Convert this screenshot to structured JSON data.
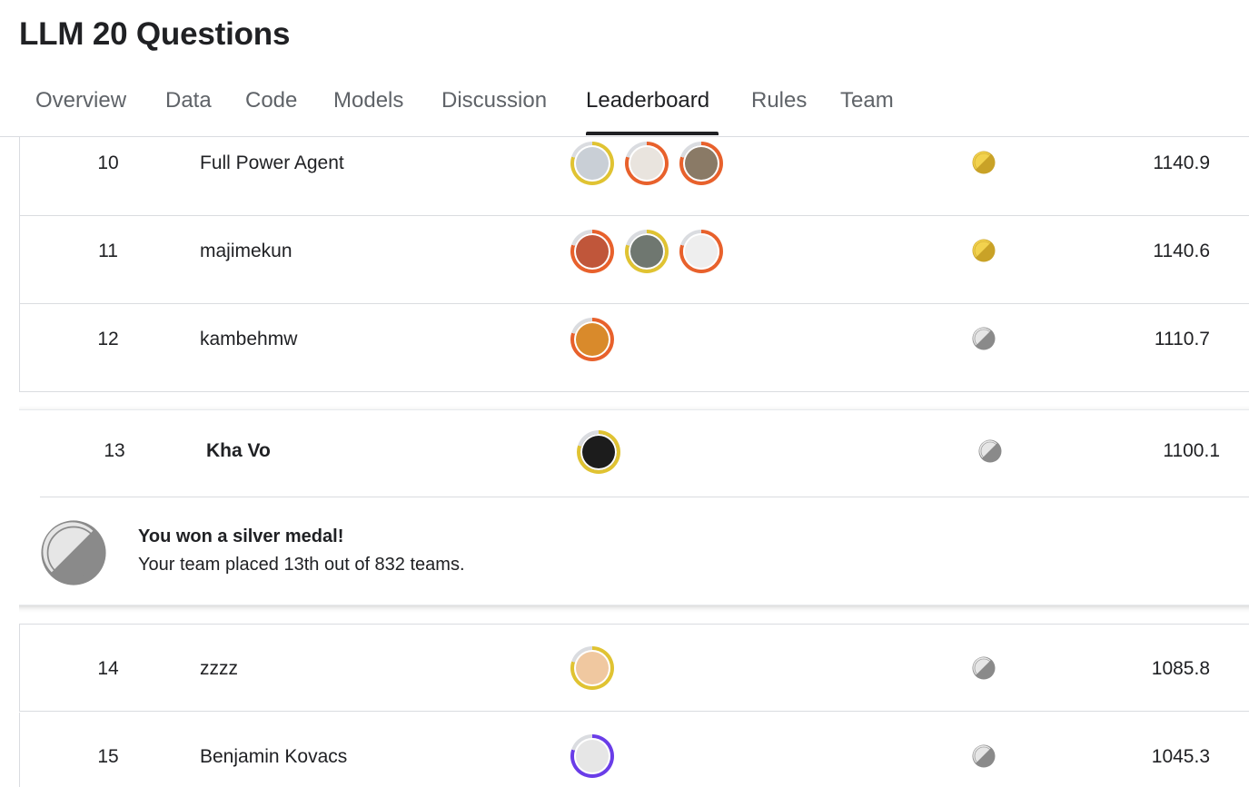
{
  "page": {
    "title": "LLM 20 Questions"
  },
  "tabs": [
    "Overview",
    "Data",
    "Code",
    "Models",
    "Discussion",
    "Leaderboard",
    "Rules",
    "Team"
  ],
  "active_tab": "Leaderboard",
  "medal_colors": {
    "gold": "#c9a227",
    "silver": "#8a8a8a",
    "ring_gold": "#e0c332",
    "ring_orange": "#e8612c",
    "ring_purple": "#6a3de8"
  },
  "rows": [
    {
      "rank": "10",
      "team": "Full Power Agent",
      "medal": "gold",
      "score": "1140.9",
      "avatars": [
        {
          "ring": "gold",
          "fill": "#c9cfd6"
        },
        {
          "ring": "orange",
          "fill": "#e9e4de"
        },
        {
          "ring": "orange",
          "fill": "#8a7a66"
        }
      ]
    },
    {
      "rank": "11",
      "team": "majimekun",
      "medal": "gold",
      "score": "1140.6",
      "avatars": [
        {
          "ring": "orange",
          "fill": "#c0563a"
        },
        {
          "ring": "gold",
          "fill": "#6f7770"
        },
        {
          "ring": "orange",
          "fill": "#eeeeee"
        }
      ]
    },
    {
      "rank": "12",
      "team": "kambehmw",
      "medal": "silver",
      "score": "1110.7",
      "avatars": [
        {
          "ring": "orange",
          "fill": "#d98a2b"
        }
      ]
    }
  ],
  "my_row": {
    "rank": "13",
    "team": "Kha Vo",
    "medal": "silver",
    "score": "1100.1",
    "avatars": [
      {
        "ring": "gold",
        "fill": "#1c1c1c"
      }
    ],
    "message_title": "You won a silver medal!",
    "message_body": "Your team placed 13th out of 832 teams."
  },
  "rows_after": [
    {
      "rank": "14",
      "team": "zzzz",
      "medal": "silver",
      "score": "1085.8",
      "avatars": [
        {
          "ring": "gold",
          "fill": "#f0c8a0"
        }
      ]
    },
    {
      "rank": "15",
      "team": "Benjamin Kovacs",
      "medal": "silver",
      "score": "1045.3",
      "avatars": [
        {
          "ring": "purple",
          "fill": "#e6e6e6"
        }
      ]
    }
  ]
}
